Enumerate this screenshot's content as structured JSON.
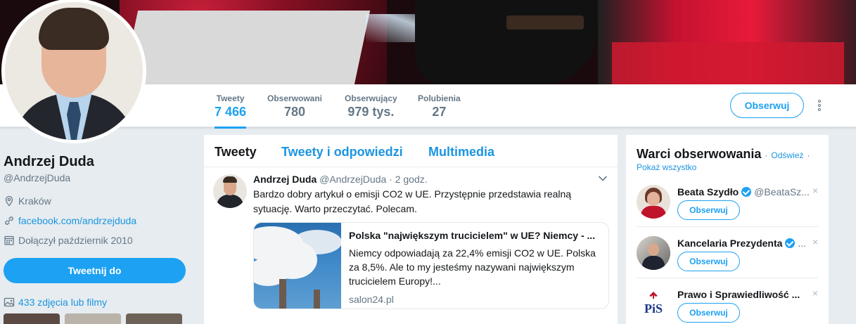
{
  "profile": {
    "name": "Andrzej Duda",
    "handle": "@AndrzejDuda",
    "location": "Kraków",
    "website": "facebook.com/andrzejduda",
    "joined": "Dołączył październik 2010",
    "tweet_to_label": "Tweetnij do",
    "media_label": "433 zdjęcia lub filmy"
  },
  "stats": [
    {
      "label": "Tweety",
      "value": "7 466"
    },
    {
      "label": "Obserwowani",
      "value": "780"
    },
    {
      "label": "Obserwujący",
      "value": "979 tys."
    },
    {
      "label": "Polubienia",
      "value": "27"
    }
  ],
  "follow_label": "Obserwuj",
  "timeline": {
    "tabs": [
      "Tweety",
      "Tweety i odpowiedzi",
      "Multimedia"
    ],
    "tweet": {
      "author": "Andrzej Duda",
      "handle": "@AndrzejDuda",
      "time": "· 2 godz.",
      "text": "Bardzo dobry artykuł o emisji CO2 w UE. Przystępnie przedstawia realną sytuację. Warto przeczytać. Polecam.",
      "card": {
        "title": "Polska \"największym trucicielem\" w UE? Niemcy - ...",
        "description": "Niemcy odpowiadają za 22,4% emisji CO2 w UE. Polska za 8,5%. Ale to my jesteśmy nazywani największym trucicielem Europy!...",
        "url": "salon24.pl"
      }
    }
  },
  "who_to_follow": {
    "title": "Warci obserwowania",
    "refresh": "Odśwież",
    "dot": "·",
    "show_all": "Pokaż wszystko",
    "follow_label": "Obserwuj",
    "close": "×",
    "items": [
      {
        "name": "Beata Szydło",
        "handle": "@BeataSz...",
        "verified": true
      },
      {
        "name": "Kancelaria Prezydenta",
        "handle": "...",
        "verified": true
      },
      {
        "name": "Prawo i Sprawiedliwość ...",
        "handle": "",
        "verified": false
      }
    ],
    "pis_logo_text": "PiS"
  },
  "colors": {
    "accent": "#1da1f2",
    "link": "#1b95e0",
    "text_secondary": "#657786",
    "background": "#e6ecf0"
  }
}
